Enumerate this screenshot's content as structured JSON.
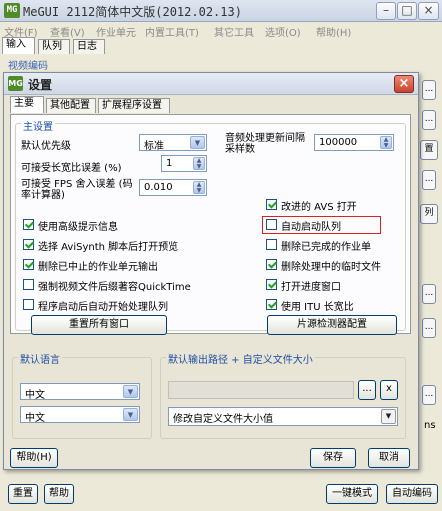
{
  "main_window": {
    "icon_text": "MG",
    "title": "MeGUI 2112简体中文版(2012.02.13)",
    "minimize": "–",
    "maximize": "□",
    "close": "×"
  },
  "menu": [
    "文件(F)",
    "查看(V)",
    "作业单元",
    "内置工具(T)",
    "其它工具",
    "选项(O)",
    "帮助(H)"
  ],
  "main_tabs": [
    "输入",
    "队列",
    "日志"
  ],
  "video_section_label": "视频编码",
  "side_buttons": [
    "...",
    "...",
    "置",
    "...",
    "列",
    "...",
    "...",
    "...",
    "ns"
  ],
  "dialog": {
    "icon_text": "MG",
    "title": "设置",
    "tabs": [
      "主要",
      "其他配置",
      "扩展程序设置"
    ],
    "main_group_title": "主设置",
    "priority_label": "默认优先级",
    "priority_value": "标准",
    "audio_label": "音频处理更新间隔采样数",
    "audio_value": "100000",
    "aspect_label": "可接受长宽比误差 (%)",
    "aspect_value": "1",
    "fps_label": "可接受 FPS 舍入误差 (码率计算器)",
    "fps_value": "0.010",
    "left_checks": [
      {
        "label": "使用高级提示信息",
        "checked": true
      },
      {
        "label": "选择 AviSynth 脚本后打开预览",
        "checked": true
      },
      {
        "label": "删除已中止的作业单元输出",
        "checked": true
      },
      {
        "label": "强制视频文件后缀著容QuickTime",
        "checked": false
      },
      {
        "label": "程序启动后自动开始处理队列",
        "checked": false
      }
    ],
    "right_checks": [
      {
        "label": "改进的 AVS 打开",
        "checked": true
      },
      {
        "label": "自动启动队列",
        "checked": false
      },
      {
        "label": "删除已完成的作业单",
        "checked": false
      },
      {
        "label": "删除处理中的临时文件",
        "checked": true
      },
      {
        "label": "打开进度窗口",
        "checked": true
      },
      {
        "label": "使用 ITU 长宽比",
        "checked": true
      }
    ],
    "reset_windows_button": "重置所有窗口",
    "source_detector_button": "片源检测器配置",
    "lang_group_title": "默认语言",
    "lang_values": [
      "中文",
      "中文"
    ],
    "output_group_title": "默认输出路径 + 自定义文件大小",
    "browse_button": "...",
    "clear_button": "x",
    "filesize_value": "修改自定义文件大小值",
    "help_button": "帮助(H)",
    "save_button": "保存",
    "cancel_button": "取消"
  },
  "bottom": {
    "reset_button": "重置",
    "help_button": "帮助",
    "oneclick_button": "一键模式",
    "autoencode_button": "自动编码"
  }
}
